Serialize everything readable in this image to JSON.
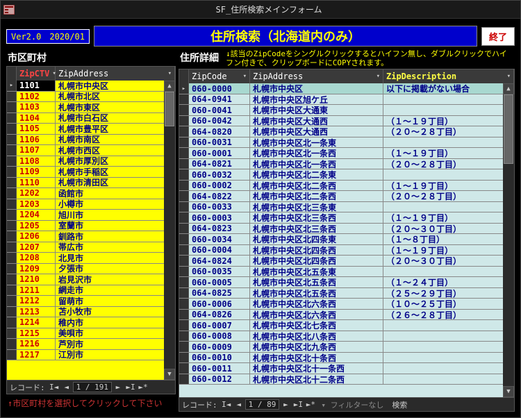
{
  "window": {
    "title": "SF_住所検索メインフォーム"
  },
  "header": {
    "version": "Ver2.0　2020/01",
    "main_title": "住所検索（北海道内のみ）",
    "end_button": "終了"
  },
  "left": {
    "title": "市区町村",
    "columns": [
      "ZipCTV",
      "ZipAddress"
    ],
    "nav": {
      "label": "レコード:",
      "pos": "1 / 191"
    },
    "hint": "↑市区町村を選択してクリックして下さい",
    "rows": [
      {
        "c": "1101",
        "a": "札幌市中央区",
        "sel": true
      },
      {
        "c": "1102",
        "a": "札幌市北区"
      },
      {
        "c": "1103",
        "a": "札幌市東区"
      },
      {
        "c": "1104",
        "a": "札幌市白石区"
      },
      {
        "c": "1105",
        "a": "札幌市豊平区"
      },
      {
        "c": "1106",
        "a": "札幌市南区"
      },
      {
        "c": "1107",
        "a": "札幌市西区"
      },
      {
        "c": "1108",
        "a": "札幌市厚別区"
      },
      {
        "c": "1109",
        "a": "札幌市手稲区"
      },
      {
        "c": "1110",
        "a": "札幌市清田区"
      },
      {
        "c": "1202",
        "a": "函館市"
      },
      {
        "c": "1203",
        "a": "小樽市"
      },
      {
        "c": "1204",
        "a": "旭川市"
      },
      {
        "c": "1205",
        "a": "室蘭市"
      },
      {
        "c": "1206",
        "a": "釧路市"
      },
      {
        "c": "1207",
        "a": "帯広市"
      },
      {
        "c": "1208",
        "a": "北見市"
      },
      {
        "c": "1209",
        "a": "夕張市"
      },
      {
        "c": "1210",
        "a": "岩見沢市"
      },
      {
        "c": "1211",
        "a": "網走市"
      },
      {
        "c": "1212",
        "a": "留萌市"
      },
      {
        "c": "1213",
        "a": "苫小牧市"
      },
      {
        "c": "1214",
        "a": "稚内市"
      },
      {
        "c": "1215",
        "a": "美唄市"
      },
      {
        "c": "1216",
        "a": "芦別市"
      },
      {
        "c": "1217",
        "a": "江別市"
      }
    ]
  },
  "right": {
    "title": "住所詳細",
    "hint": "↓該当のZipCodeをシングルクリックするとハイフン無し、ダブルクリックでハイフン付きで、クリップボードにCOPYされます。",
    "columns": [
      "ZipCode",
      "ZipAddress",
      "ZipDescription"
    ],
    "nav": {
      "label": "レコード:",
      "pos": "1 / 89",
      "filter": "フィルターなし",
      "search": "検索"
    },
    "rows": [
      {
        "z": "060-0000",
        "a": "札幌市中央区",
        "d": "以下に掲載がない場合",
        "sel": true
      },
      {
        "z": "064-0941",
        "a": "札幌市中央区旭ケ丘",
        "d": ""
      },
      {
        "z": "060-0041",
        "a": "札幌市中央区大通東",
        "d": ""
      },
      {
        "z": "060-0042",
        "a": "札幌市中央区大通西",
        "d": "（１～１９丁目）"
      },
      {
        "z": "064-0820",
        "a": "札幌市中央区大通西",
        "d": "（２０～２８丁目）"
      },
      {
        "z": "060-0031",
        "a": "札幌市中央区北一条東",
        "d": ""
      },
      {
        "z": "060-0001",
        "a": "札幌市中央区北一条西",
        "d": "（１～１９丁目）"
      },
      {
        "z": "064-0821",
        "a": "札幌市中央区北一条西",
        "d": "（２０～２８丁目）"
      },
      {
        "z": "060-0032",
        "a": "札幌市中央区北二条東",
        "d": ""
      },
      {
        "z": "060-0002",
        "a": "札幌市中央区北二条西",
        "d": "（１～１９丁目）"
      },
      {
        "z": "064-0822",
        "a": "札幌市中央区北二条西",
        "d": "（２０～２８丁目）"
      },
      {
        "z": "060-0033",
        "a": "札幌市中央区北三条東",
        "d": ""
      },
      {
        "z": "060-0003",
        "a": "札幌市中央区北三条西",
        "d": "（１～１９丁目）"
      },
      {
        "z": "064-0823",
        "a": "札幌市中央区北三条西",
        "d": "（２０～３０丁目）"
      },
      {
        "z": "060-0034",
        "a": "札幌市中央区北四条東",
        "d": "（１～８丁目）"
      },
      {
        "z": "060-0004",
        "a": "札幌市中央区北四条西",
        "d": "（１～１９丁目）"
      },
      {
        "z": "064-0824",
        "a": "札幌市中央区北四条西",
        "d": "（２０～３０丁目）"
      },
      {
        "z": "060-0035",
        "a": "札幌市中央区北五条東",
        "d": ""
      },
      {
        "z": "060-0005",
        "a": "札幌市中央区北五条西",
        "d": "（１～２４丁目）"
      },
      {
        "z": "064-0825",
        "a": "札幌市中央区北五条西",
        "d": "（２５～２９丁目）"
      },
      {
        "z": "060-0006",
        "a": "札幌市中央区北六条西",
        "d": "（１０～２５丁目）"
      },
      {
        "z": "064-0826",
        "a": "札幌市中央区北六条西",
        "d": "（２６～２８丁目）"
      },
      {
        "z": "060-0007",
        "a": "札幌市中央区北七条西",
        "d": ""
      },
      {
        "z": "060-0008",
        "a": "札幌市中央区北八条西",
        "d": ""
      },
      {
        "z": "060-0009",
        "a": "札幌市中央区北九条西",
        "d": ""
      },
      {
        "z": "060-0010",
        "a": "札幌市中央区北十条西",
        "d": ""
      },
      {
        "z": "060-0011",
        "a": "札幌市中央区北十一条西",
        "d": ""
      },
      {
        "z": "060-0012",
        "a": "札幌市中央区北十二条西",
        "d": ""
      }
    ]
  }
}
